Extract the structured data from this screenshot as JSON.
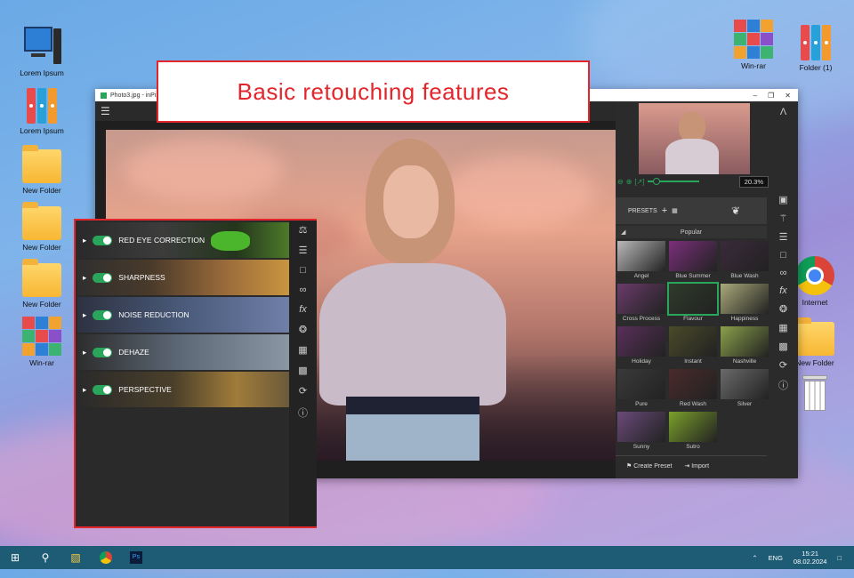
{
  "callout": {
    "text": "Basic retouching features"
  },
  "desktop": {
    "left_icons": [
      {
        "label": "Lorem Ipsum",
        "icon": "computer-icon"
      },
      {
        "label": "Lorem Ipsum",
        "icon": "binders-icon"
      },
      {
        "label": "New Folder",
        "icon": "folder-icon"
      },
      {
        "label": "New Folder",
        "icon": "folder-icon"
      },
      {
        "label": "New Folder",
        "icon": "folder-icon"
      },
      {
        "label": "Win-rar",
        "icon": "winrar-icon"
      }
    ],
    "right_icons": [
      {
        "label": "Win-rar",
        "icon": "winrar-icon"
      },
      {
        "label": "Folder (1)",
        "icon": "binders-icon"
      },
      {
        "label": "Internet",
        "icon": "chrome-icon"
      },
      {
        "label": "New Folder",
        "icon": "folder-icon"
      },
      {
        "label": "",
        "icon": "recycle-bin-icon"
      }
    ]
  },
  "window": {
    "title": "Photo3.jpg - inPixio P"
  },
  "zoom": {
    "value": "20.3%"
  },
  "presets": {
    "label": "PRESETS",
    "category": "Popular",
    "items": [
      "Angel",
      "Blue Summer",
      "Blue Wash",
      "Cross Process",
      "Flavour",
      "Happiness",
      "Holiday",
      "Instant",
      "Nashville",
      "Pure",
      "Red Wash",
      "Silver",
      "Sunny",
      "Sutro"
    ],
    "selected": "Flavour",
    "create_label": "Create Preset",
    "import_label": "Import"
  },
  "features": [
    {
      "label": "RED EYE CORRECTION"
    },
    {
      "label": "SHARPNESS"
    },
    {
      "label": "NOISE REDUCTION"
    },
    {
      "label": "DEHAZE"
    },
    {
      "label": "PERSPECTIVE"
    }
  ],
  "taskbar": {
    "lang": "ENG",
    "time": "15:21",
    "date": "08.02.2024"
  },
  "colors": {
    "accent": "#2aa65c",
    "callout": "#e3262c",
    "taskbar": "#1e5b75"
  }
}
